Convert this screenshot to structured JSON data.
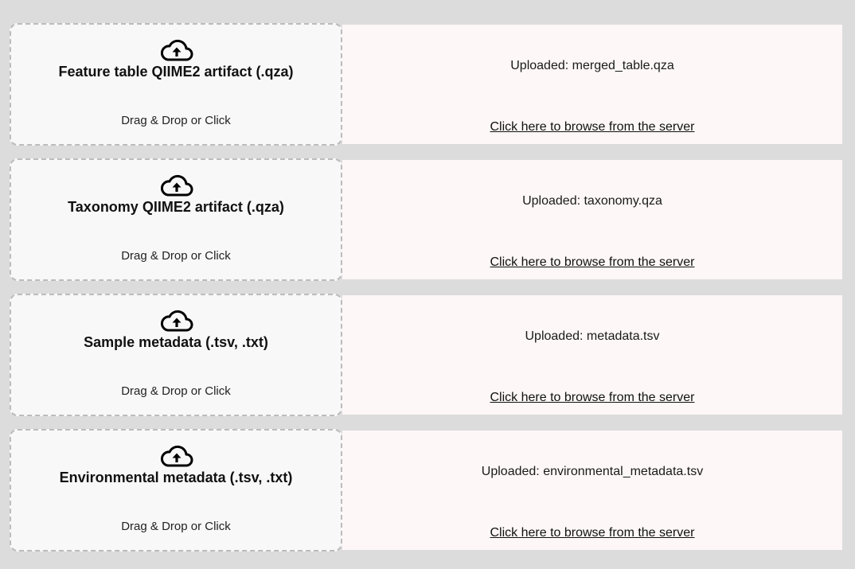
{
  "uploads": [
    {
      "icon": "cloud-upload-icon",
      "title": "Feature table QIIME2 artifact (.qza)",
      "hint": "Drag & Drop or Click",
      "status": "Uploaded: merged_table.qza",
      "browse_label": "Click here to browse from the server"
    },
    {
      "icon": "cloud-upload-icon",
      "title": "Taxonomy QIIME2 artifact (.qza)",
      "hint": "Drag & Drop or Click",
      "status": "Uploaded: taxonomy.qza",
      "browse_label": "Click here to browse from the server"
    },
    {
      "icon": "cloud-upload-icon",
      "title": "Sample metadata (.tsv, .txt)",
      "hint": "Drag & Drop or Click",
      "status": "Uploaded: metadata.tsv",
      "browse_label": "Click here to browse from the server"
    },
    {
      "icon": "cloud-upload-icon",
      "title": "Environmental metadata (.tsv, .txt)",
      "hint": "Drag & Drop or Click",
      "status": "Uploaded: environmental_metadata.tsv",
      "browse_label": "Click here to browse from the server"
    }
  ]
}
